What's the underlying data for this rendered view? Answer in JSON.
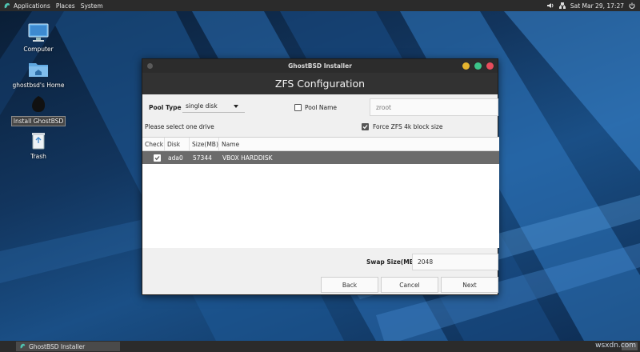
{
  "top_panel": {
    "menus": [
      "Applications",
      "Places",
      "System"
    ],
    "clock": "Sat Mar 29, 17:27"
  },
  "desktop": {
    "icons": [
      {
        "label": "Computer",
        "icon": "computer-icon"
      },
      {
        "label": "ghostbsd's Home",
        "icon": "home-folder-icon"
      },
      {
        "label": "Install GhostBSD",
        "icon": "ghostbsd-install-icon"
      },
      {
        "label": "Trash",
        "icon": "trash-icon"
      }
    ]
  },
  "window": {
    "title": "GhostBSD Installer",
    "header": "ZFS Configuration",
    "pool_type_label": "Pool Type",
    "pool_type_value": "single disk",
    "pool_name_label": "Pool Name",
    "pool_name_placeholder": "zroot",
    "select_drive_text": "Please select one drive",
    "force_4k_label": "Force ZFS 4k block size",
    "table": {
      "headers": [
        "Check",
        "Disk",
        "Size(MB)",
        "Name"
      ],
      "rows": [
        {
          "disk": "ada0",
          "size": "57344",
          "name": "VBOX HARDDISK"
        }
      ]
    },
    "swap_label": "Swap Size(MB)",
    "swap_value": "2048",
    "buttons": {
      "back": "Back",
      "cancel": "Cancel",
      "next": "Next"
    }
  },
  "taskbar": {
    "task": "GhostBSD Installer"
  },
  "watermark": "wsxdn.com",
  "colors": {
    "accent_close": "#e74c5c",
    "accent_max": "#3cc48a",
    "accent_min": "#e6b52f"
  }
}
